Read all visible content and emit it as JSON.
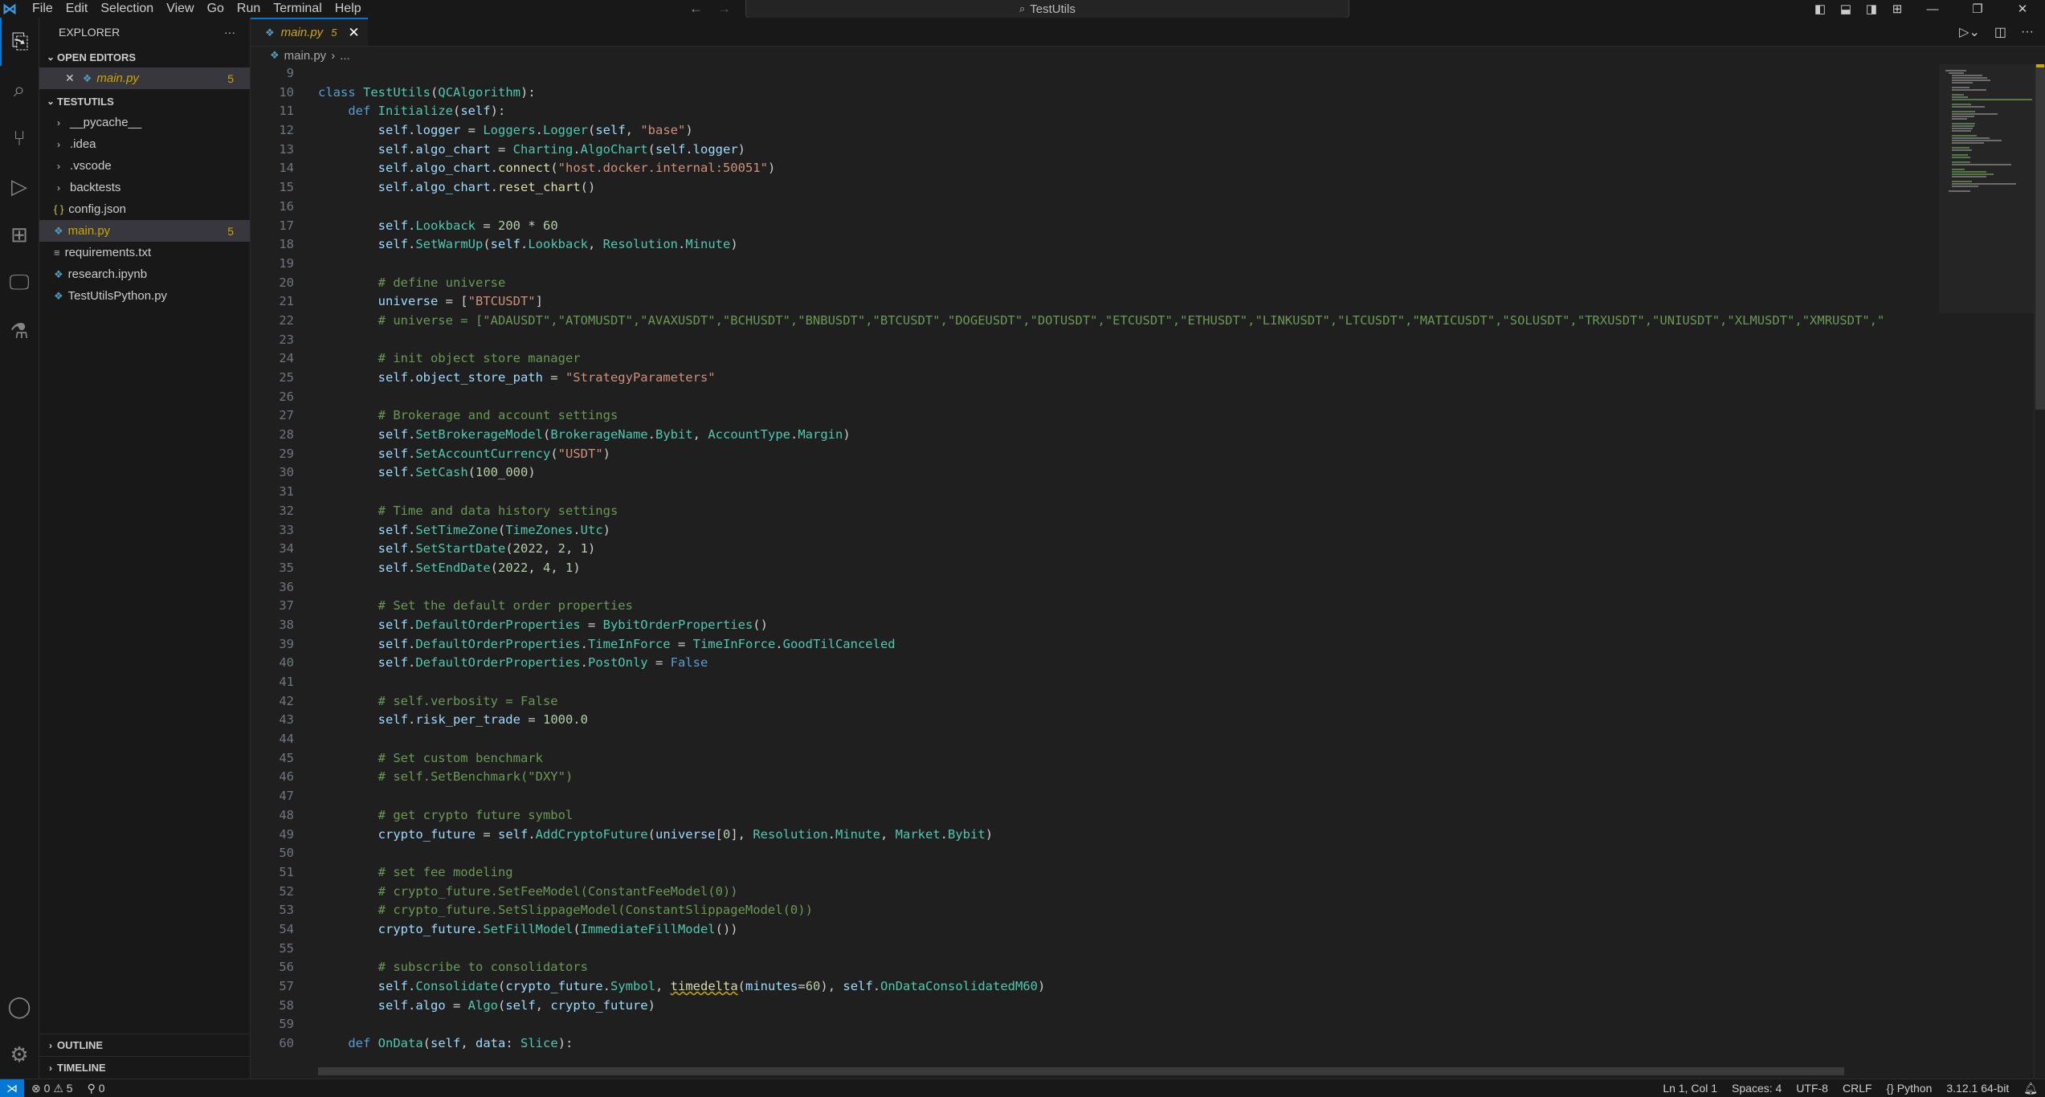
{
  "menu": [
    "File",
    "Edit",
    "Selection",
    "View",
    "Go",
    "Run",
    "Terminal",
    "Help"
  ],
  "search": {
    "label": "TestUtils"
  },
  "explorer": {
    "title": "EXPLORER",
    "more": "···",
    "open_editors": {
      "header": "OPEN EDITORS",
      "items": [
        {
          "label": "main.py",
          "count": "5"
        }
      ]
    },
    "project": {
      "header": "TESTUTILS",
      "folders": [
        "__pycache__",
        ".idea",
        ".vscode",
        "backtests"
      ],
      "files": [
        {
          "label": "config.json",
          "kind": "json"
        },
        {
          "label": "main.py",
          "kind": "python",
          "count": "5"
        },
        {
          "label": "requirements.txt",
          "kind": "text"
        },
        {
          "label": "research.ipynb",
          "kind": "python"
        },
        {
          "label": "TestUtilsPython.py",
          "kind": "python"
        }
      ]
    },
    "outline": "OUTLINE",
    "timeline": "TIMELINE"
  },
  "tab": {
    "name": "main.py",
    "problems": "5"
  },
  "breadcrumb": {
    "file": "main.py",
    "rest": "..."
  },
  "code": [
    {
      "n": "9",
      "t": ""
    },
    {
      "n": "10",
      "t": "class TestUtils(QCAlgorithm):"
    },
    {
      "n": "11",
      "t": "    def Initialize(self):"
    },
    {
      "n": "12",
      "t": "        self.logger = Loggers.Logger(self, \"base\")"
    },
    {
      "n": "13",
      "t": "        self.algo_chart = Charting.AlgoChart(self.logger)"
    },
    {
      "n": "14",
      "t": "        self.algo_chart.connect(\"host.docker.internal:50051\")"
    },
    {
      "n": "15",
      "t": "        self.algo_chart.reset_chart()"
    },
    {
      "n": "16",
      "t": ""
    },
    {
      "n": "17",
      "t": "        self.Lookback = 200 * 60"
    },
    {
      "n": "18",
      "t": "        self.SetWarmUp(self.Lookback, Resolution.Minute)"
    },
    {
      "n": "19",
      "t": ""
    },
    {
      "n": "20",
      "t": "        # define universe"
    },
    {
      "n": "21",
      "t": "        universe = [\"BTCUSDT\"]"
    },
    {
      "n": "22",
      "t": "        # universe = [\"ADAUSDT\",\"ATOMUSDT\",\"AVAXUSDT\",\"BCHUSDT\",\"BNBUSDT\",\"BTCUSDT\",\"DOGEUSDT\",\"DOTUSDT\",\"ETCUSDT\",\"ETHUSDT\",\"LINKUSDT\",\"LTCUSDT\",\"MATICUSDT\",\"SOLUSDT\",\"TRXUSDT\",\"UNIUSDT\",\"XLMUSDT\",\"XMRUSDT\",\""
    },
    {
      "n": "23",
      "t": ""
    },
    {
      "n": "24",
      "t": "        # init object store manager"
    },
    {
      "n": "25",
      "t": "        self.object_store_path = \"StrategyParameters\""
    },
    {
      "n": "26",
      "t": ""
    },
    {
      "n": "27",
      "t": "        # Brokerage and account settings"
    },
    {
      "n": "28",
      "t": "        self.SetBrokerageModel(BrokerageName.Bybit, AccountType.Margin)"
    },
    {
      "n": "29",
      "t": "        self.SetAccountCurrency(\"USDT\")"
    },
    {
      "n": "30",
      "t": "        self.SetCash(100_000)"
    },
    {
      "n": "31",
      "t": ""
    },
    {
      "n": "32",
      "t": "        # Time and data history settings"
    },
    {
      "n": "33",
      "t": "        self.SetTimeZone(TimeZones.Utc)"
    },
    {
      "n": "34",
      "t": "        self.SetStartDate(2022, 2, 1)"
    },
    {
      "n": "35",
      "t": "        self.SetEndDate(2022, 4, 1)"
    },
    {
      "n": "36",
      "t": ""
    },
    {
      "n": "37",
      "t": "        # Set the default order properties"
    },
    {
      "n": "38",
      "t": "        self.DefaultOrderProperties = BybitOrderProperties()"
    },
    {
      "n": "39",
      "t": "        self.DefaultOrderProperties.TimeInForce = TimeInForce.GoodTilCanceled"
    },
    {
      "n": "40",
      "t": "        self.DefaultOrderProperties.PostOnly = False"
    },
    {
      "n": "41",
      "t": ""
    },
    {
      "n": "42",
      "t": "        # self.verbosity = False"
    },
    {
      "n": "43",
      "t": "        self.risk_per_trade = 1000.0"
    },
    {
      "n": "44",
      "t": ""
    },
    {
      "n": "45",
      "t": "        # Set custom benchmark"
    },
    {
      "n": "46",
      "t": "        # self.SetBenchmark(\"DXY\")"
    },
    {
      "n": "47",
      "t": ""
    },
    {
      "n": "48",
      "t": "        # get crypto future symbol"
    },
    {
      "n": "49",
      "t": "        crypto_future = self.AddCryptoFuture(universe[0], Resolution.Minute, Market.Bybit)"
    },
    {
      "n": "50",
      "t": ""
    },
    {
      "n": "51",
      "t": "        # set fee modeling"
    },
    {
      "n": "52",
      "t": "        # crypto_future.SetFeeModel(ConstantFeeModel(0))"
    },
    {
      "n": "53",
      "t": "        # crypto_future.SetSlippageModel(ConstantSlippageModel(0))"
    },
    {
      "n": "54",
      "t": "        crypto_future.SetFillModel(ImmediateFillModel())"
    },
    {
      "n": "55",
      "t": ""
    },
    {
      "n": "56",
      "t": "        # subscribe to consolidators"
    },
    {
      "n": "57",
      "t": "        self.Consolidate(crypto_future.Symbol, timedelta(minutes=60), self.OnDataConsolidatedM60)"
    },
    {
      "n": "58",
      "t": "        self.algo = Algo(self, crypto_future)"
    },
    {
      "n": "59",
      "t": ""
    },
    {
      "n": "60",
      "t": "    def OnData(self, data: Slice):"
    }
  ],
  "status": {
    "errors": "0",
    "warnings": "5",
    "ports": "0",
    "position": "Ln 1, Col 1",
    "spaces": "Spaces: 4",
    "encoding": "UTF-8",
    "eol": "CRLF",
    "language": "Python",
    "interpreter": "3.12.1 64-bit"
  },
  "colors": {
    "accent": "#0078d4",
    "warning": "#cca700",
    "keyword": "#569cd6",
    "class": "#4ec9b0",
    "function": "#dcdcaa",
    "string": "#ce9178",
    "number": "#b5cea8",
    "comment": "#6a9955",
    "variable": "#9cdcfe"
  },
  "icons": {
    "activity": [
      "explorer-icon",
      "search-icon",
      "source-control-icon",
      "run-debug-icon",
      "extensions-icon",
      "remote-explorer-icon",
      "testing-icon"
    ],
    "activity_bottom": [
      "account-icon",
      "settings-gear-icon"
    ]
  }
}
